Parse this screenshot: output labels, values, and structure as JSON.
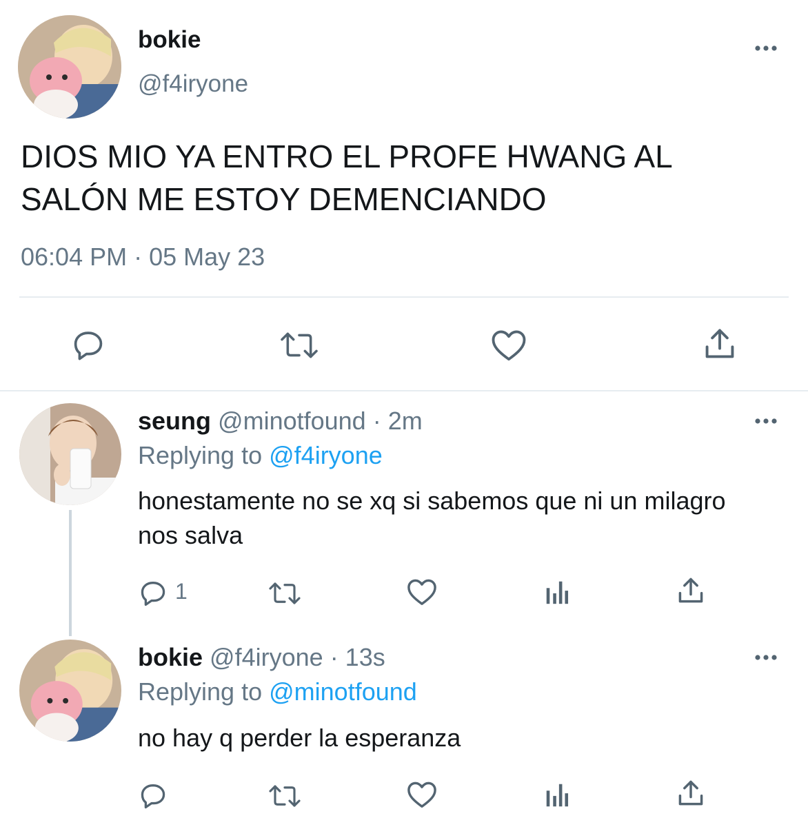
{
  "main_tweet": {
    "display_name": "bokie",
    "handle": "@f4iryone",
    "text": "DIOS MIO YA ENTRO EL PROFE HWANG AL SALÓN ME ESTOY DEMENCIANDO",
    "timestamp": "06:04 PM · 05 May 23",
    "actions": [
      "reply-icon",
      "retweet-icon",
      "like-icon",
      "share-icon"
    ]
  },
  "replies": [
    {
      "display_name": "seung",
      "handle": "@minotfound",
      "time_sep": "· 2m",
      "replying_prefix": "Replying to",
      "replying_to": "@f4iryone",
      "text": "honestamente no se xq si sabemos que ni un milagro nos salva",
      "reply_count": "1",
      "actions": [
        "reply-icon",
        "retweet-icon",
        "like-icon",
        "analytics-icon",
        "share-icon"
      ]
    },
    {
      "display_name": "bokie",
      "handle": "@f4iryone",
      "time_sep": "· 13s",
      "replying_prefix": "Replying to",
      "replying_to": "@minotfound",
      "text": "no hay q perder la esperanza",
      "reply_count": "",
      "actions": [
        "reply-icon",
        "retweet-icon",
        "like-icon",
        "analytics-icon",
        "share-icon"
      ]
    }
  ],
  "colors": {
    "text": "#14171a",
    "muted": "#657786",
    "link": "#1da1f2",
    "icon": "#536471",
    "divider": "#e6ecf0"
  }
}
